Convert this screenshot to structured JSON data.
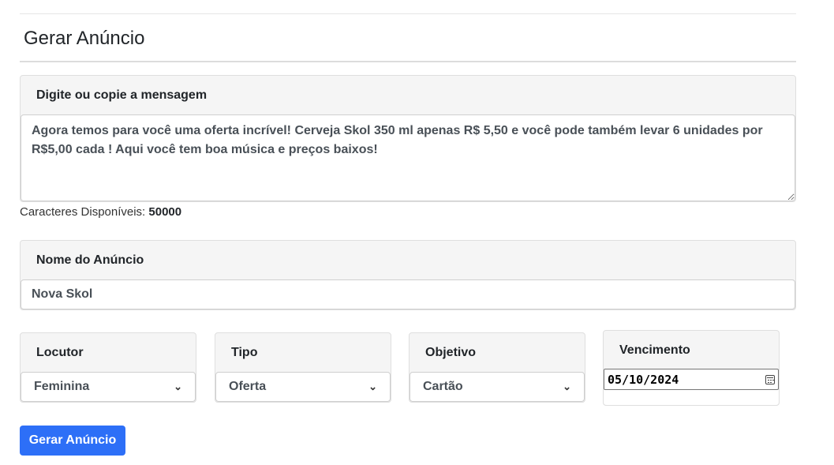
{
  "page": {
    "title": "Gerar Anúncio"
  },
  "message": {
    "header": "Digite ou copie a mensagem",
    "value": "Agora temos para você uma oferta incrível! Cerveja Skol 350 ml apenas R$ 5,50 e você pode também levar 6 unidades por R$5,00 cada ! Aqui você tem boa música e preços baixos!",
    "chars_label": "Caracteres Disponíveis:",
    "chars_value": "50000"
  },
  "ad_name": {
    "header": "Nome do Anúncio",
    "value": "Nova Skol"
  },
  "locutor": {
    "header": "Locutor",
    "selected": "Feminina"
  },
  "tipo": {
    "header": "Tipo",
    "selected": "Oferta"
  },
  "objetivo": {
    "header": "Objetivo",
    "selected": "Cartão"
  },
  "vencimento": {
    "header": "Vencimento",
    "value": "05/10/2024"
  },
  "submit": {
    "label": "Gerar Anúncio"
  },
  "colors": {
    "button": "#2d6ff7",
    "card_header_bg": "#f5f5f5"
  },
  "icons": {
    "select": "chevron-down-icon",
    "date": "calendar-icon"
  }
}
